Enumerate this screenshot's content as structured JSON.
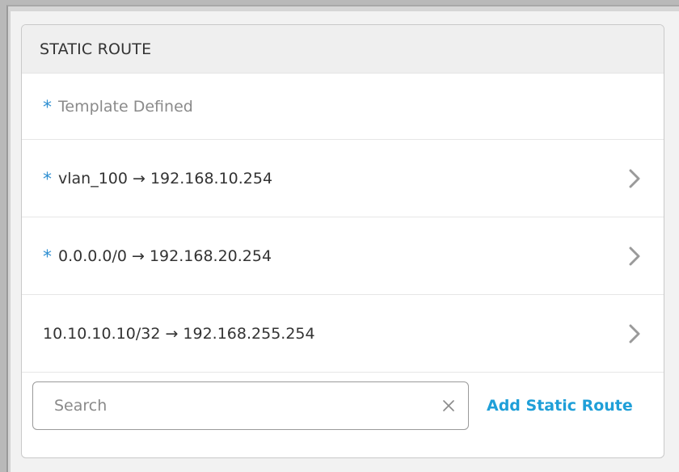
{
  "panel": {
    "title": "STATIC ROUTE"
  },
  "template": {
    "marker": "*",
    "label": "Template Defined"
  },
  "routes": [
    {
      "marker": "*",
      "text": "vlan_100 → 192.168.10.254",
      "template_defined": true
    },
    {
      "marker": "*",
      "text": "0.0.0.0/0 → 192.168.20.254",
      "template_defined": true
    },
    {
      "marker": "",
      "text": "10.10.10.10/32 → 192.168.255.254",
      "template_defined": false
    }
  ],
  "search": {
    "placeholder": "Search",
    "value": ""
  },
  "actions": {
    "add_label": "Add Static Route"
  },
  "colors": {
    "accent": "#2f8fd1",
    "link": "#1f9fd8",
    "header_bg": "#efefef",
    "text": "#333333",
    "muted": "#8a8a8a"
  },
  "icons": {
    "marker": "asterisk-icon",
    "row_action": "chevron-right-icon",
    "clear": "close-icon"
  }
}
